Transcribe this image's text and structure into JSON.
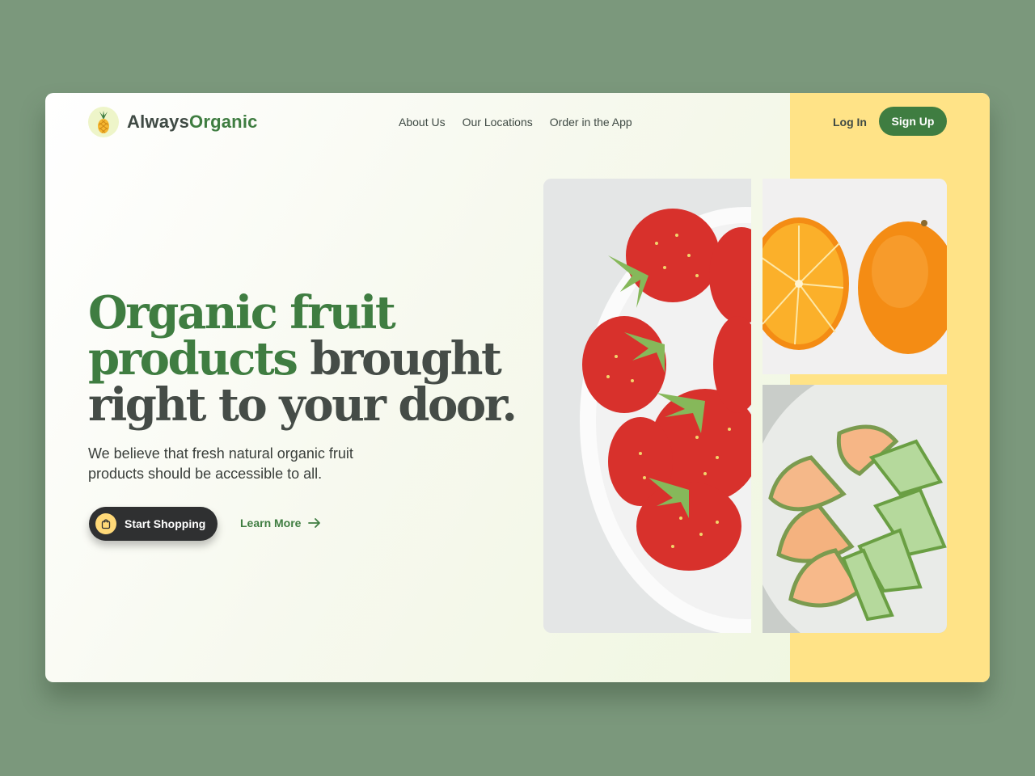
{
  "brand": {
    "name_part1": "Always",
    "name_part2": "Organic",
    "logo_icon": "pineapple-icon"
  },
  "nav": {
    "items": [
      "About Us",
      "Our Locations",
      "Order in the App"
    ]
  },
  "auth": {
    "login_label": "Log In",
    "signup_label": "Sign Up"
  },
  "hero": {
    "headline_green": "Organic fruit products",
    "headline_dark": " brought right to your door.",
    "subtitle": "We believe that fresh natural organic fruit products should be accessible to all.",
    "primary_button": "Start Shopping",
    "secondary_link": "Learn More"
  },
  "images": [
    "strawberries",
    "oranges",
    "melon"
  ],
  "colors": {
    "page_background": "#7b987c",
    "brand_green": "#3f7d41",
    "dark_text": "#454c47",
    "accent_yellow": "#ffe387",
    "button_dark": "#2f3031"
  }
}
